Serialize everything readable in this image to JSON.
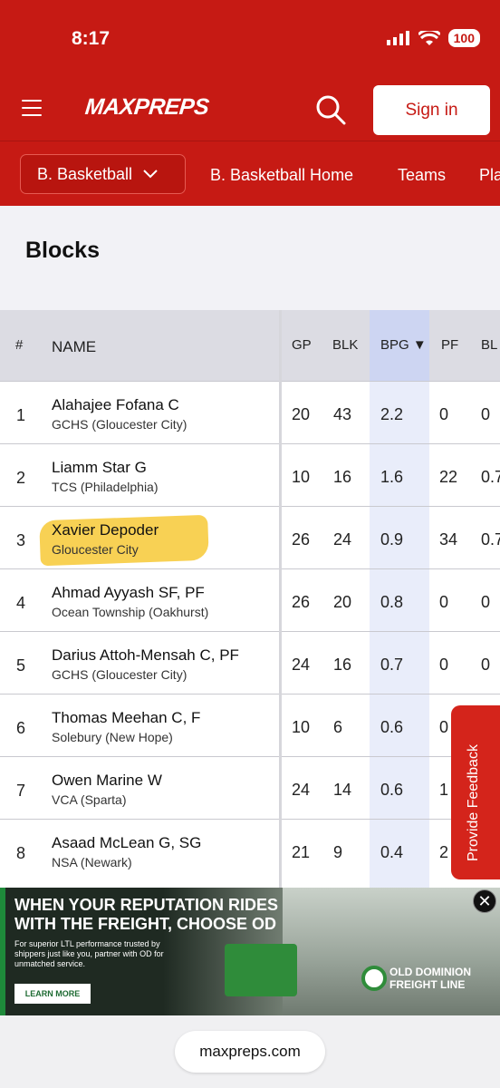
{
  "status": {
    "time": "8:17",
    "battery": "100"
  },
  "header": {
    "logo": "MAXPREPS",
    "signin_label": "Sign in"
  },
  "subnav": {
    "sport": "B. Basketball",
    "links": [
      "B. Basketball Home",
      "Teams",
      "Pla"
    ]
  },
  "page": {
    "title": "Blocks"
  },
  "table": {
    "columns": [
      "#",
      "NAME",
      "GP",
      "BLK",
      "BPG ▼",
      "PF",
      "BL"
    ],
    "rows": [
      {
        "rank": "1",
        "name": "Alahajee Fofana C",
        "school": "GCHS (Gloucester City)",
        "gp": "20",
        "blk": "43",
        "bpg": "2.2",
        "pf": "0",
        "bl": "0"
      },
      {
        "rank": "2",
        "name": "Liamm Star G",
        "school": "TCS (Philadelphia)",
        "gp": "10",
        "blk": "16",
        "bpg": "1.6",
        "pf": "22",
        "bl": "0.7"
      },
      {
        "rank": "3",
        "name": "Xavier Depoder",
        "school": "Gloucester City",
        "gp": "26",
        "blk": "24",
        "bpg": "0.9",
        "pf": "34",
        "bl": "0.7"
      },
      {
        "rank": "4",
        "name": "Ahmad Ayyash SF, PF",
        "school": "Ocean Township (Oakhurst)",
        "gp": "26",
        "blk": "20",
        "bpg": "0.8",
        "pf": "0",
        "bl": "0"
      },
      {
        "rank": "5",
        "name": "Darius Attoh-Mensah C, PF",
        "school": "GCHS (Gloucester City)",
        "gp": "24",
        "blk": "16",
        "bpg": "0.7",
        "pf": "0",
        "bl": "0"
      },
      {
        "rank": "6",
        "name": "Thomas Meehan C, F",
        "school": "Solebury (New Hope)",
        "gp": "10",
        "blk": "6",
        "bpg": "0.6",
        "pf": "0",
        "bl": ""
      },
      {
        "rank": "7",
        "name": "Owen Marine W",
        "school": "VCA (Sparta)",
        "gp": "24",
        "blk": "14",
        "bpg": "0.6",
        "pf": "1",
        "bl": ""
      },
      {
        "rank": "8",
        "name": "Asaad McLean G, SG",
        "school": "NSA (Newark)",
        "gp": "21",
        "blk": "9",
        "bpg": "0.4",
        "pf": "2",
        "bl": ""
      }
    ]
  },
  "feedback": {
    "label": "Provide Feedback"
  },
  "ad": {
    "headline": "WHEN YOUR REPUTATION RIDES WITH THE FREIGHT, CHOOSE OD",
    "body": "For superior LTL performance trusted by shippers just like you, partner with OD for unmatched service.",
    "button": "LEARN MORE",
    "brand_line1": "OLD DOMINION",
    "brand_line2": "FREIGHT LINE",
    "close": "✕"
  },
  "browser": {
    "url": "maxpreps.com"
  },
  "colors": {
    "brand": "#c61a14",
    "highlight": "#f6c21b",
    "sort_column": "#e9edfa"
  }
}
